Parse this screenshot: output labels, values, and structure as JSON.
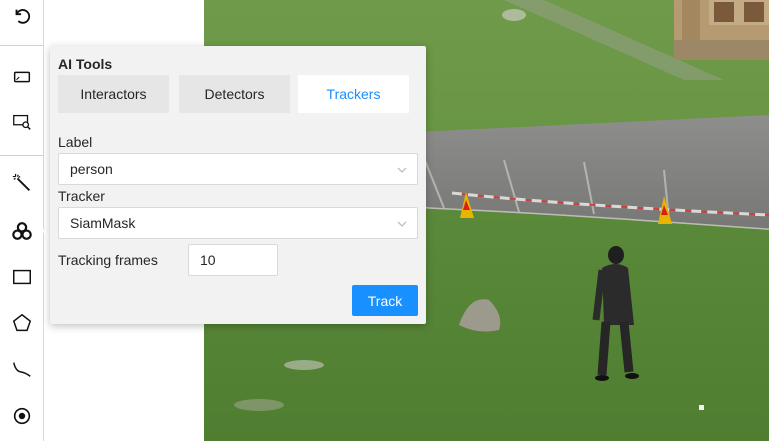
{
  "toolbar": {
    "tools": [
      {
        "icon": "undo-icon"
      },
      {
        "icon": "fit-image-icon"
      },
      {
        "icon": "zoom-region-icon"
      },
      {
        "icon": "magic-wand-icon"
      },
      {
        "icon": "ai-tools-icon"
      },
      {
        "icon": "rectangle-icon"
      },
      {
        "icon": "polygon-icon"
      },
      {
        "icon": "polyline-icon"
      },
      {
        "icon": "points-icon"
      }
    ]
  },
  "ai_tools": {
    "title": "AI Tools",
    "tabs": [
      {
        "label": "Interactors",
        "active": false
      },
      {
        "label": "Detectors",
        "active": false
      },
      {
        "label": "Trackers",
        "active": true
      }
    ],
    "label_field": {
      "label": "Label",
      "value": "person"
    },
    "tracker_field": {
      "label": "Tracker",
      "value": "SiamMask"
    },
    "tracking_frames": {
      "label": "Tracking frames",
      "value": "10"
    },
    "track_button": "Track"
  },
  "colors": {
    "accent": "#1890ff",
    "panel_bg": "#f2f2f2",
    "tab_bg": "#e6e6e6",
    "grass": "#5e8a3a",
    "asphalt": "#8a8a88"
  }
}
